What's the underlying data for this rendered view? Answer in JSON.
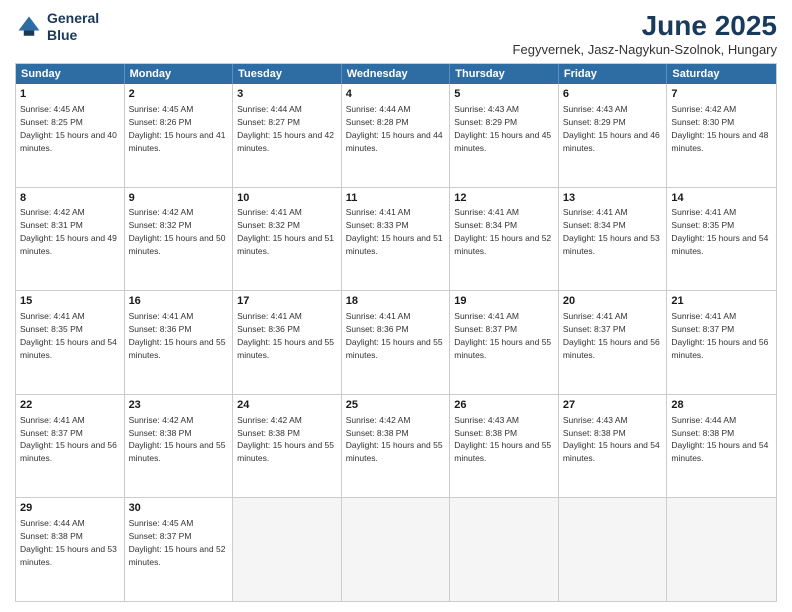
{
  "logo": {
    "line1": "General",
    "line2": "Blue"
  },
  "title": "June 2025",
  "subtitle": "Fegyvernek, Jasz-Nagykun-Szolnok, Hungary",
  "header_days": [
    "Sunday",
    "Monday",
    "Tuesday",
    "Wednesday",
    "Thursday",
    "Friday",
    "Saturday"
  ],
  "weeks": [
    [
      {
        "day": "1",
        "sunrise": "Sunrise: 4:45 AM",
        "sunset": "Sunset: 8:25 PM",
        "daylight": "Daylight: 15 hours and 40 minutes."
      },
      {
        "day": "2",
        "sunrise": "Sunrise: 4:45 AM",
        "sunset": "Sunset: 8:26 PM",
        "daylight": "Daylight: 15 hours and 41 minutes."
      },
      {
        "day": "3",
        "sunrise": "Sunrise: 4:44 AM",
        "sunset": "Sunset: 8:27 PM",
        "daylight": "Daylight: 15 hours and 42 minutes."
      },
      {
        "day": "4",
        "sunrise": "Sunrise: 4:44 AM",
        "sunset": "Sunset: 8:28 PM",
        "daylight": "Daylight: 15 hours and 44 minutes."
      },
      {
        "day": "5",
        "sunrise": "Sunrise: 4:43 AM",
        "sunset": "Sunset: 8:29 PM",
        "daylight": "Daylight: 15 hours and 45 minutes."
      },
      {
        "day": "6",
        "sunrise": "Sunrise: 4:43 AM",
        "sunset": "Sunset: 8:29 PM",
        "daylight": "Daylight: 15 hours and 46 minutes."
      },
      {
        "day": "7",
        "sunrise": "Sunrise: 4:42 AM",
        "sunset": "Sunset: 8:30 PM",
        "daylight": "Daylight: 15 hours and 48 minutes."
      }
    ],
    [
      {
        "day": "8",
        "sunrise": "Sunrise: 4:42 AM",
        "sunset": "Sunset: 8:31 PM",
        "daylight": "Daylight: 15 hours and 49 minutes."
      },
      {
        "day": "9",
        "sunrise": "Sunrise: 4:42 AM",
        "sunset": "Sunset: 8:32 PM",
        "daylight": "Daylight: 15 hours and 50 minutes."
      },
      {
        "day": "10",
        "sunrise": "Sunrise: 4:41 AM",
        "sunset": "Sunset: 8:32 PM",
        "daylight": "Daylight: 15 hours and 51 minutes."
      },
      {
        "day": "11",
        "sunrise": "Sunrise: 4:41 AM",
        "sunset": "Sunset: 8:33 PM",
        "daylight": "Daylight: 15 hours and 51 minutes."
      },
      {
        "day": "12",
        "sunrise": "Sunrise: 4:41 AM",
        "sunset": "Sunset: 8:34 PM",
        "daylight": "Daylight: 15 hours and 52 minutes."
      },
      {
        "day": "13",
        "sunrise": "Sunrise: 4:41 AM",
        "sunset": "Sunset: 8:34 PM",
        "daylight": "Daylight: 15 hours and 53 minutes."
      },
      {
        "day": "14",
        "sunrise": "Sunrise: 4:41 AM",
        "sunset": "Sunset: 8:35 PM",
        "daylight": "Daylight: 15 hours and 54 minutes."
      }
    ],
    [
      {
        "day": "15",
        "sunrise": "Sunrise: 4:41 AM",
        "sunset": "Sunset: 8:35 PM",
        "daylight": "Daylight: 15 hours and 54 minutes."
      },
      {
        "day": "16",
        "sunrise": "Sunrise: 4:41 AM",
        "sunset": "Sunset: 8:36 PM",
        "daylight": "Daylight: 15 hours and 55 minutes."
      },
      {
        "day": "17",
        "sunrise": "Sunrise: 4:41 AM",
        "sunset": "Sunset: 8:36 PM",
        "daylight": "Daylight: 15 hours and 55 minutes."
      },
      {
        "day": "18",
        "sunrise": "Sunrise: 4:41 AM",
        "sunset": "Sunset: 8:36 PM",
        "daylight": "Daylight: 15 hours and 55 minutes."
      },
      {
        "day": "19",
        "sunrise": "Sunrise: 4:41 AM",
        "sunset": "Sunset: 8:37 PM",
        "daylight": "Daylight: 15 hours and 55 minutes."
      },
      {
        "day": "20",
        "sunrise": "Sunrise: 4:41 AM",
        "sunset": "Sunset: 8:37 PM",
        "daylight": "Daylight: 15 hours and 56 minutes."
      },
      {
        "day": "21",
        "sunrise": "Sunrise: 4:41 AM",
        "sunset": "Sunset: 8:37 PM",
        "daylight": "Daylight: 15 hours and 56 minutes."
      }
    ],
    [
      {
        "day": "22",
        "sunrise": "Sunrise: 4:41 AM",
        "sunset": "Sunset: 8:37 PM",
        "daylight": "Daylight: 15 hours and 56 minutes."
      },
      {
        "day": "23",
        "sunrise": "Sunrise: 4:42 AM",
        "sunset": "Sunset: 8:38 PM",
        "daylight": "Daylight: 15 hours and 55 minutes."
      },
      {
        "day": "24",
        "sunrise": "Sunrise: 4:42 AM",
        "sunset": "Sunset: 8:38 PM",
        "daylight": "Daylight: 15 hours and 55 minutes."
      },
      {
        "day": "25",
        "sunrise": "Sunrise: 4:42 AM",
        "sunset": "Sunset: 8:38 PM",
        "daylight": "Daylight: 15 hours and 55 minutes."
      },
      {
        "day": "26",
        "sunrise": "Sunrise: 4:43 AM",
        "sunset": "Sunset: 8:38 PM",
        "daylight": "Daylight: 15 hours and 55 minutes."
      },
      {
        "day": "27",
        "sunrise": "Sunrise: 4:43 AM",
        "sunset": "Sunset: 8:38 PM",
        "daylight": "Daylight: 15 hours and 54 minutes."
      },
      {
        "day": "28",
        "sunrise": "Sunrise: 4:44 AM",
        "sunset": "Sunset: 8:38 PM",
        "daylight": "Daylight: 15 hours and 54 minutes."
      }
    ],
    [
      {
        "day": "29",
        "sunrise": "Sunrise: 4:44 AM",
        "sunset": "Sunset: 8:38 PM",
        "daylight": "Daylight: 15 hours and 53 minutes."
      },
      {
        "day": "30",
        "sunrise": "Sunrise: 4:45 AM",
        "sunset": "Sunset: 8:37 PM",
        "daylight": "Daylight: 15 hours and 52 minutes."
      },
      {
        "day": "",
        "sunrise": "",
        "sunset": "",
        "daylight": ""
      },
      {
        "day": "",
        "sunrise": "",
        "sunset": "",
        "daylight": ""
      },
      {
        "day": "",
        "sunrise": "",
        "sunset": "",
        "daylight": ""
      },
      {
        "day": "",
        "sunrise": "",
        "sunset": "",
        "daylight": ""
      },
      {
        "day": "",
        "sunrise": "",
        "sunset": "",
        "daylight": ""
      }
    ]
  ]
}
